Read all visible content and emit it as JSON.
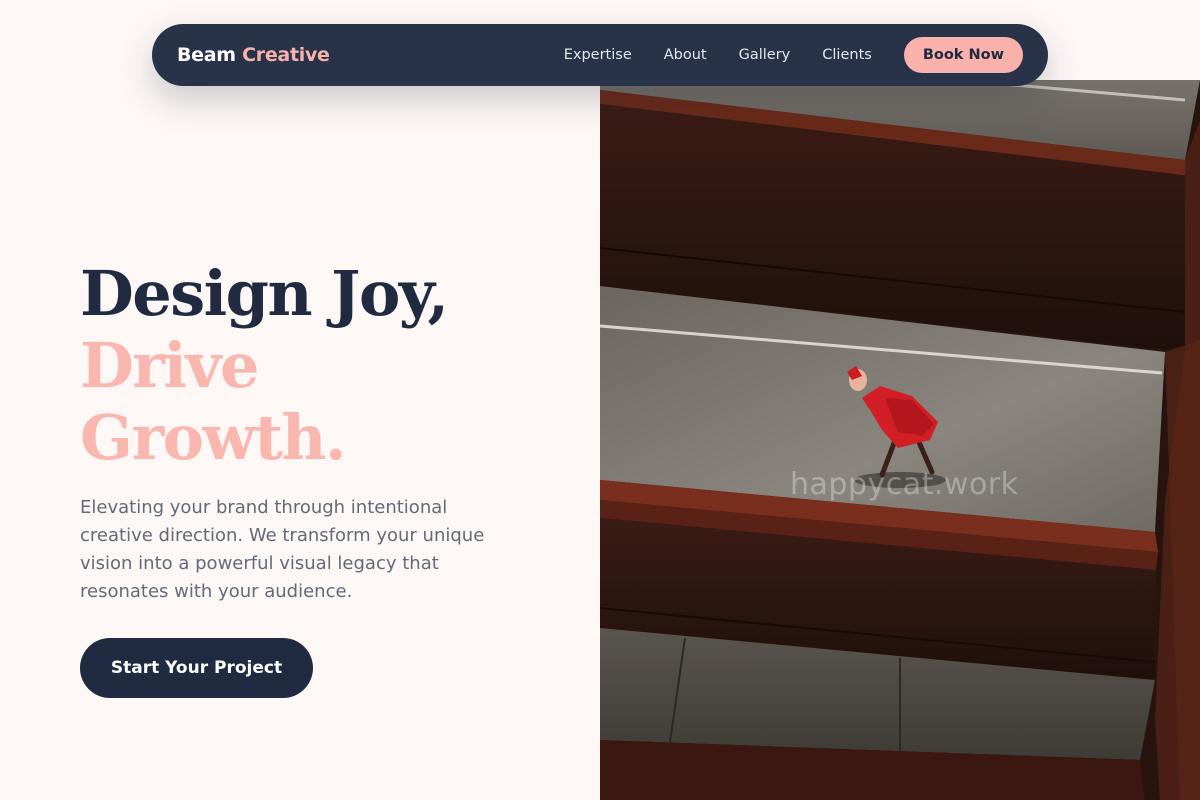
{
  "header": {
    "brand_primary": "Beam",
    "brand_accent": "Creative",
    "nav_links": [
      {
        "label": "Expertise"
      },
      {
        "label": "About"
      },
      {
        "label": "Gallery"
      },
      {
        "label": "Clients"
      }
    ],
    "cta_label": "Book Now"
  },
  "hero": {
    "headline_line1": "Design Joy,",
    "headline_line2": "Drive",
    "headline_line3": "Growth.",
    "description": "Elevating your brand through intentional creative direction. We transform your unique vision into a powerful visual legacy that resonates with your audience.",
    "cta_label": "Start Your Project"
  },
  "photo": {
    "watermark": "happycat.work"
  },
  "colors": {
    "navy": "#28334a",
    "pink": "#f9b1ab",
    "background": "#fdf7f6"
  }
}
